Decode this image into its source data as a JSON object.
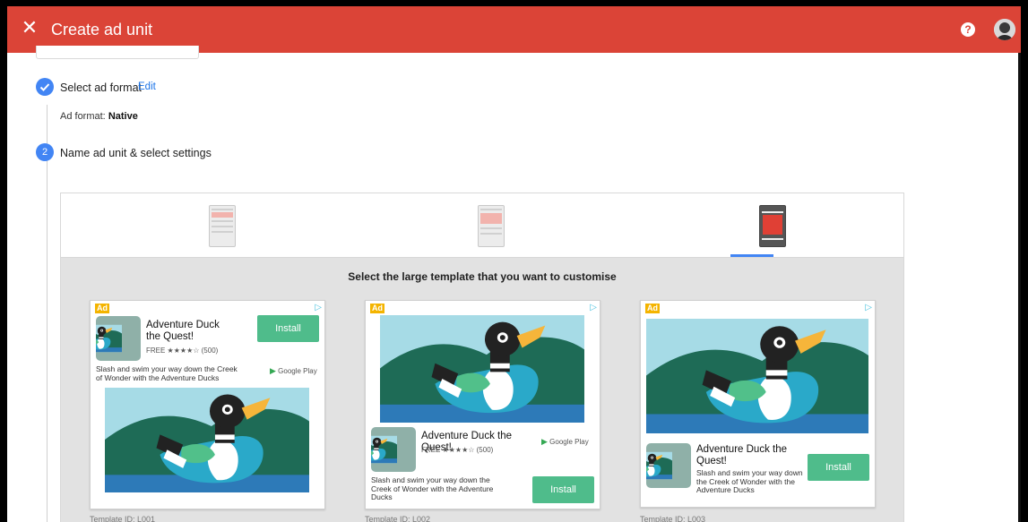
{
  "header": {
    "title": "Create ad unit",
    "close_icon": "close-icon",
    "help_icon": "help-icon",
    "avatar_icon": "avatar"
  },
  "steps": {
    "step1": {
      "label": "Select ad format",
      "edit": "Edit",
      "format_label": "Ad format:",
      "format_value": "Native"
    },
    "step2": {
      "number": "2",
      "label": "Name ad unit & select settings"
    }
  },
  "size_tabs": [
    {
      "name": "small",
      "selected": false
    },
    {
      "name": "medium",
      "selected": false
    },
    {
      "name": "large",
      "selected": true
    }
  ],
  "templates": {
    "heading": "Select the large template that you want to customise",
    "badge": "Ad",
    "app_title": "Adventure Duck the Quest!",
    "rating_text": "FREE ★★★★☆ (500)",
    "description": "Slash and swim your way down the Creek of Wonder with the Adventure Ducks",
    "install": "Install",
    "store": "Google Play",
    "ids": [
      "Template ID: L001",
      "Template ID: L002",
      "Template ID: L003"
    ]
  },
  "colors": {
    "topbar": "#db4437",
    "accent": "#4285f4",
    "install": "#4fbc8b",
    "ad_badge": "#f4b400"
  }
}
